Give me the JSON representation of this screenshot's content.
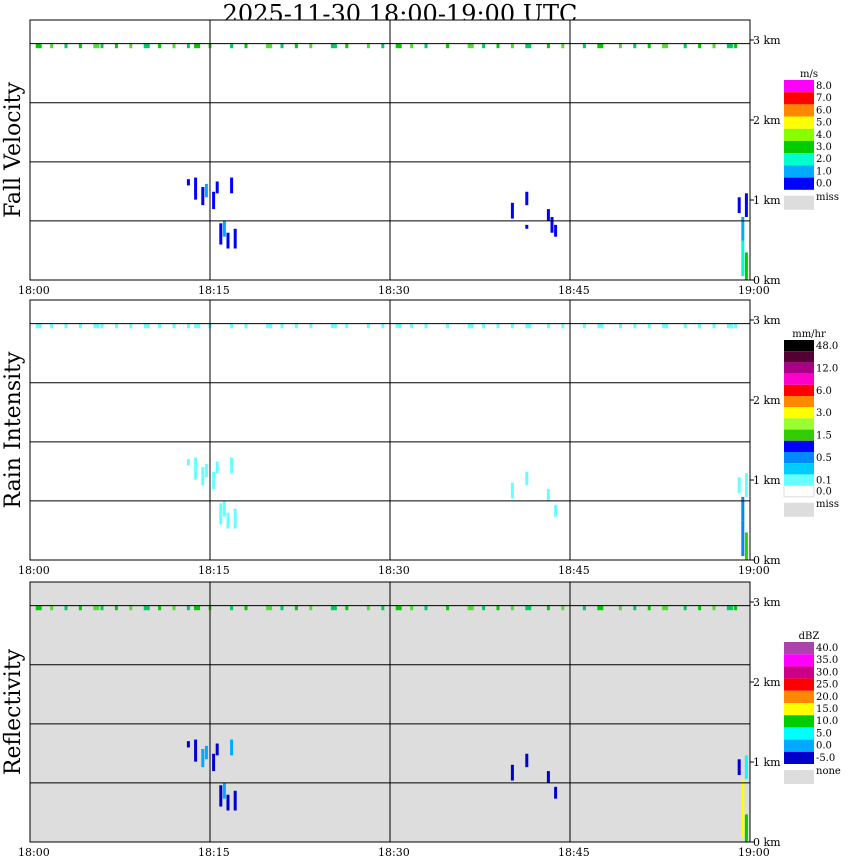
{
  "title": "2025-11-30   18:00-19:00 UTC",
  "chart_data": [
    {
      "type": "heatmap",
      "panel": "fall_velocity",
      "ylabel": "Fall Velocity",
      "x_ticks": [
        "18:00",
        "18:15",
        "18:30",
        "18:45",
        "19:00"
      ],
      "y_ticks": [
        "0 km",
        "1 km",
        "2 km",
        "3 km"
      ],
      "xlim": [
        "18:00",
        "19:00"
      ],
      "ylim_km": [
        0,
        3
      ],
      "grid": true,
      "background": "#ffffff",
      "legend": {
        "unit": "m/s",
        "levels": [
          {
            "label": "8.0",
            "color": "#ff00ff"
          },
          {
            "label": "7.0",
            "color": "#ff0000"
          },
          {
            "label": "6.0",
            "color": "#ff8800"
          },
          {
            "label": "5.0",
            "color": "#ffff00"
          },
          {
            "label": "4.0",
            "color": "#88ff00"
          },
          {
            "label": "3.0",
            "color": "#00cc00"
          },
          {
            "label": "2.0",
            "color": "#00ffcc"
          },
          {
            "label": "1.0",
            "color": "#00aaff"
          },
          {
            "label": "0.0",
            "color": "#0000ff"
          }
        ],
        "missing": {
          "label": "miss",
          "color": "#dddddd"
        }
      },
      "cells": [
        {
          "t": 18.22,
          "z0": 1.2,
          "z1": 1.28,
          "v": 0.5
        },
        {
          "t": 18.23,
          "z0": 1.02,
          "z1": 1.3,
          "v": 0.5
        },
        {
          "t": 18.24,
          "z0": 0.95,
          "z1": 1.18,
          "v": 0.8
        },
        {
          "t": 18.245,
          "z0": 1.05,
          "z1": 1.22,
          "v": 1.5
        },
        {
          "t": 18.255,
          "z0": 0.9,
          "z1": 1.12,
          "v": 0.5
        },
        {
          "t": 18.26,
          "z0": 1.1,
          "z1": 1.25,
          "v": 0.7
        },
        {
          "t": 18.265,
          "z0": 0.45,
          "z1": 0.72,
          "v": 0.5
        },
        {
          "t": 18.27,
          "z0": 0.55,
          "z1": 0.75,
          "v": 1.5
        },
        {
          "t": 18.275,
          "z0": 0.4,
          "z1": 0.6,
          "v": 0.6
        },
        {
          "t": 18.28,
          "z0": 1.1,
          "z1": 1.3,
          "v": 0.5
        },
        {
          "t": 18.285,
          "z0": 0.4,
          "z1": 0.65,
          "v": 0.5
        },
        {
          "t": 18.67,
          "z0": 0.78,
          "z1": 0.98,
          "v": 0.5
        },
        {
          "t": 18.69,
          "z0": 0.95,
          "z1": 1.12,
          "v": 0.5
        },
        {
          "t": 18.69,
          "z0": 0.65,
          "z1": 0.7,
          "v": 0.5
        },
        {
          "t": 18.72,
          "z0": 0.75,
          "z1": 0.9,
          "v": 0.5
        },
        {
          "t": 18.725,
          "z0": 0.6,
          "z1": 0.8,
          "v": 0.8
        },
        {
          "t": 18.73,
          "z0": 0.55,
          "z1": 0.7,
          "v": 0.5
        },
        {
          "t": 18.985,
          "z0": 0.85,
          "z1": 1.05,
          "v": 0.5
        },
        {
          "t": 18.99,
          "z0": 0.05,
          "z1": 0.5,
          "v": 2.5
        },
        {
          "t": 18.99,
          "z0": 0.5,
          "z1": 0.8,
          "v": 1.5
        },
        {
          "t": 18.995,
          "z0": 0.0,
          "z1": 0.35,
          "v": 3.5
        },
        {
          "t": 18.995,
          "z0": 0.8,
          "z1": 1.1,
          "v": 0.5
        }
      ]
    },
    {
      "type": "heatmap",
      "panel": "rain_intensity",
      "ylabel": "Rain Intensity",
      "x_ticks": [
        "18:00",
        "18:15",
        "18:30",
        "18:45",
        "19:00"
      ],
      "y_ticks": [
        "0 km",
        "1 km",
        "2 km",
        "3 km"
      ],
      "xlim": [
        "18:00",
        "19:00"
      ],
      "ylim_km": [
        0,
        3
      ],
      "grid": true,
      "background": "#ffffff",
      "legend": {
        "unit": "mm/hr",
        "levels": [
          {
            "label": "48.0",
            "color": "#000000"
          },
          {
            "label": "",
            "color": "#550033"
          },
          {
            "label": "12.0",
            "color": "#aa0088"
          },
          {
            "label": "",
            "color": "#ff00cc"
          },
          {
            "label": "6.0",
            "color": "#ff0000"
          },
          {
            "label": "",
            "color": "#ff8800"
          },
          {
            "label": "3.0",
            "color": "#ffff00"
          },
          {
            "label": "",
            "color": "#99ff33"
          },
          {
            "label": "1.5",
            "color": "#33cc00"
          },
          {
            "label": "",
            "color": "#0000ff"
          },
          {
            "label": "0.5",
            "color": "#0088ff"
          },
          {
            "label": "",
            "color": "#00ccff"
          },
          {
            "label": "0.1",
            "color": "#66ffff"
          },
          {
            "label": "0.0",
            "color": "#ffffff"
          }
        ],
        "missing": {
          "label": "miss",
          "color": "#dddddd"
        }
      },
      "cells": [
        {
          "t": 18.22,
          "z0": 1.2,
          "z1": 1.28,
          "v": 0.1
        },
        {
          "t": 18.23,
          "z0": 1.02,
          "z1": 1.3,
          "v": 0.1
        },
        {
          "t": 18.24,
          "z0": 0.95,
          "z1": 1.18,
          "v": 0.1
        },
        {
          "t": 18.245,
          "z0": 1.05,
          "z1": 1.22,
          "v": 0.1
        },
        {
          "t": 18.255,
          "z0": 0.9,
          "z1": 1.12,
          "v": 0.1
        },
        {
          "t": 18.26,
          "z0": 1.1,
          "z1": 1.25,
          "v": 0.1
        },
        {
          "t": 18.265,
          "z0": 0.45,
          "z1": 0.72,
          "v": 0.1
        },
        {
          "t": 18.27,
          "z0": 0.55,
          "z1": 0.75,
          "v": 0.1
        },
        {
          "t": 18.275,
          "z0": 0.4,
          "z1": 0.6,
          "v": 0.1
        },
        {
          "t": 18.28,
          "z0": 1.1,
          "z1": 1.3,
          "v": 0.1
        },
        {
          "t": 18.285,
          "z0": 0.4,
          "z1": 0.65,
          "v": 0.1
        },
        {
          "t": 18.67,
          "z0": 0.78,
          "z1": 0.98,
          "v": 0.1
        },
        {
          "t": 18.69,
          "z0": 0.95,
          "z1": 1.12,
          "v": 0.1
        },
        {
          "t": 18.72,
          "z0": 0.75,
          "z1": 0.9,
          "v": 0.1
        },
        {
          "t": 18.73,
          "z0": 0.55,
          "z1": 0.7,
          "v": 0.1
        },
        {
          "t": 18.985,
          "z0": 0.85,
          "z1": 1.05,
          "v": 0.1
        },
        {
          "t": 18.99,
          "z0": 0.05,
          "z1": 0.5,
          "v": 1.0
        },
        {
          "t": 18.99,
          "z0": 0.5,
          "z1": 0.8,
          "v": 0.5
        },
        {
          "t": 18.995,
          "z0": 0.0,
          "z1": 0.35,
          "v": 1.5
        },
        {
          "t": 18.995,
          "z0": 0.8,
          "z1": 1.1,
          "v": 0.1
        }
      ]
    },
    {
      "type": "heatmap",
      "panel": "reflectivity",
      "ylabel": "Reflectivity",
      "x_ticks": [
        "18:00",
        "18:15",
        "18:30",
        "18:45",
        "19:00"
      ],
      "y_ticks": [
        "0 km",
        "1 km",
        "2 km",
        "3 km"
      ],
      "xlim": [
        "18:00",
        "19:00"
      ],
      "ylim_km": [
        0,
        3
      ],
      "grid": true,
      "background": "#dddddd",
      "legend": {
        "unit": "dBZ",
        "levels": [
          {
            "label": "40.0",
            "color": "#aa44aa"
          },
          {
            "label": "35.0",
            "color": "#ff00ff"
          },
          {
            "label": "30.0",
            "color": "#cc0088"
          },
          {
            "label": "25.0",
            "color": "#ff0000"
          },
          {
            "label": "20.0",
            "color": "#ff8800"
          },
          {
            "label": "15.0",
            "color": "#ffff00"
          },
          {
            "label": "10.0",
            "color": "#00cc00"
          },
          {
            "label": "5.0",
            "color": "#00ffff"
          },
          {
            "label": "0.0",
            "color": "#00aaff"
          },
          {
            "label": "-5.0",
            "color": "#0000cc"
          }
        ],
        "missing": {
          "label": "none",
          "color": "#dddddd"
        }
      },
      "cells": [
        {
          "t": 18.22,
          "z0": 1.2,
          "z1": 1.28,
          "v": -3
        },
        {
          "t": 18.23,
          "z0": 1.02,
          "z1": 1.3,
          "v": -3
        },
        {
          "t": 18.24,
          "z0": 0.95,
          "z1": 1.18,
          "v": 0
        },
        {
          "t": 18.245,
          "z0": 1.05,
          "z1": 1.22,
          "v": 2
        },
        {
          "t": 18.255,
          "z0": 0.9,
          "z1": 1.12,
          "v": -3
        },
        {
          "t": 18.26,
          "z0": 1.1,
          "z1": 1.25,
          "v": -3
        },
        {
          "t": 18.265,
          "z0": 0.45,
          "z1": 0.72,
          "v": -3
        },
        {
          "t": 18.27,
          "z0": 0.55,
          "z1": 0.75,
          "v": 2
        },
        {
          "t": 18.275,
          "z0": 0.4,
          "z1": 0.6,
          "v": -3
        },
        {
          "t": 18.28,
          "z0": 1.1,
          "z1": 1.3,
          "v": 2
        },
        {
          "t": 18.285,
          "z0": 0.4,
          "z1": 0.65,
          "v": -3
        },
        {
          "t": 18.67,
          "z0": 0.78,
          "z1": 0.98,
          "v": -3
        },
        {
          "t": 18.69,
          "z0": 0.95,
          "z1": 1.12,
          "v": -3
        },
        {
          "t": 18.72,
          "z0": 0.75,
          "z1": 0.9,
          "v": -3
        },
        {
          "t": 18.73,
          "z0": 0.55,
          "z1": 0.7,
          "v": -3
        },
        {
          "t": 18.985,
          "z0": 0.85,
          "z1": 1.05,
          "v": -3
        },
        {
          "t": 18.99,
          "z0": 0.05,
          "z1": 0.8,
          "v": 17
        },
        {
          "t": 18.995,
          "z0": 0.0,
          "z1": 0.35,
          "v": 12
        },
        {
          "t": 18.995,
          "z0": 0.8,
          "z1": 1.1,
          "v": 7
        }
      ]
    }
  ],
  "top_band": {
    "altitude_km": 2.98,
    "times": [
      18.01,
      18.03,
      18.05,
      18.07,
      18.09,
      18.1,
      18.12,
      18.14,
      18.16,
      18.18,
      18.2,
      18.22,
      18.23,
      18.25,
      18.28,
      18.3,
      18.33,
      18.35,
      18.37,
      18.39,
      18.42,
      18.44,
      18.47,
      18.49,
      18.51,
      18.53,
      18.55,
      18.58,
      18.61,
      18.63,
      18.65,
      18.67,
      18.69,
      18.72,
      18.74,
      18.77,
      18.79,
      18.82,
      18.84,
      18.86,
      18.88,
      18.91,
      18.93,
      18.95,
      18.97,
      18.98
    ]
  }
}
